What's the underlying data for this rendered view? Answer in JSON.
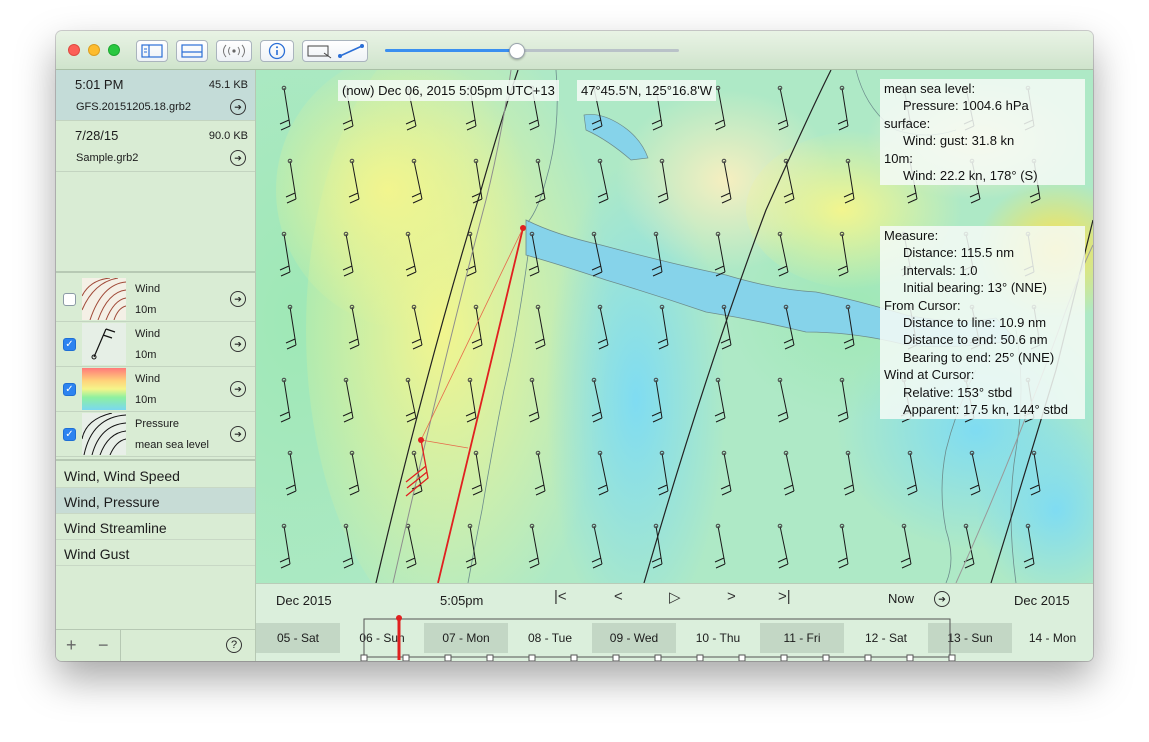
{
  "toolbar": {
    "buttons": [
      {
        "name": "sidebar-toggle-button",
        "icon": "sidebar-icon"
      },
      {
        "name": "timeline-toggle-button",
        "icon": "panel-icon"
      },
      {
        "name": "broadcast-button",
        "icon": "antenna-icon"
      },
      {
        "name": "info-button",
        "icon": "info-icon"
      },
      {
        "name": "route-tool-button",
        "icon": "route-icon"
      }
    ],
    "slider_value": 0.45,
    "accent": "#3a8ff0"
  },
  "files": [
    {
      "time": "5:01 PM",
      "size": "45.1 KB",
      "name": "GFS.20151205.18.grb2",
      "selected": true
    },
    {
      "time": "7/28/15",
      "size": "90.0 KB",
      "name": "Sample.grb2",
      "selected": false
    }
  ],
  "layers": [
    {
      "checked": false,
      "label": "Wind",
      "sub": "10m",
      "thumb": "streamline"
    },
    {
      "checked": true,
      "label": "Wind",
      "sub": "10m",
      "thumb": "barb"
    },
    {
      "checked": true,
      "label": "Wind",
      "sub": "10m",
      "thumb": "gradient"
    },
    {
      "checked": true,
      "label": "Pressure",
      "sub": "mean sea level",
      "thumb": "isobar"
    }
  ],
  "presets": [
    {
      "label": "Wind, Wind Speed",
      "selected": false
    },
    {
      "label": "Wind, Pressure",
      "selected": true
    },
    {
      "label": "Wind Streamline",
      "selected": false
    },
    {
      "label": "Wind Gust",
      "selected": false
    }
  ],
  "footer": {
    "add": "+",
    "remove": "−",
    "help": "?"
  },
  "map": {
    "time_label": "(now) Dec 06, 2015 5:05pm UTC+13",
    "position_label": "47°45.5'N, 125°16.8'W"
  },
  "data_panel": [
    {
      "text": "mean sea level:",
      "indent": false
    },
    {
      "text": "Pressure: 1004.6 hPa",
      "indent": true
    },
    {
      "text": "surface:",
      "indent": false
    },
    {
      "text": "Wind: gust: 31.8 kn",
      "indent": true
    },
    {
      "text": "10m:",
      "indent": false
    },
    {
      "text": "Wind: 22.2 kn, 178° (S)",
      "indent": true
    }
  ],
  "measure_panel": [
    {
      "text": "Measure:",
      "indent": false
    },
    {
      "text": "Distance: 115.5 nm",
      "indent": true
    },
    {
      "text": "Intervals: 1.0",
      "indent": true
    },
    {
      "text": "Initial bearing: 13° (NNE)",
      "indent": true
    },
    {
      "text": "From Cursor:",
      "indent": false
    },
    {
      "text": "Distance to line: 10.9 nm",
      "indent": true
    },
    {
      "text": "Distance to end: 50.6 nm",
      "indent": true
    },
    {
      "text": "Bearing to end: 25° (NNE)",
      "indent": true
    },
    {
      "text": "Wind at Cursor:",
      "indent": false
    },
    {
      "text": "Relative: 153° stbd",
      "indent": true
    },
    {
      "text": "Apparent: 17.5 kn, 144° stbd",
      "indent": true
    }
  ],
  "timeline": {
    "left_month": "Dec 2015",
    "right_month": "Dec 2015",
    "current_time": "5:05pm",
    "now_label": "Now",
    "controls": {
      "first": "|<",
      "prev": "<",
      "play": "▷",
      "next": ">",
      "last": ">|"
    },
    "days": [
      "05 - Sat",
      "06 - Sun",
      "07 - Mon",
      "08 - Tue",
      "09 - Wed",
      "10 - Thu",
      "11 - Fri",
      "12 - Sat",
      "13 - Sun",
      "14 - Mon"
    ],
    "cursor_color": "#e02020"
  }
}
